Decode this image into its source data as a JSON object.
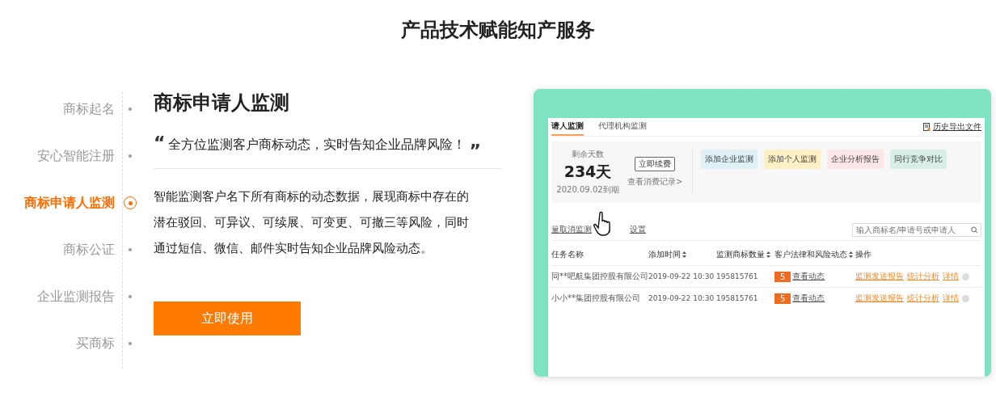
{
  "title": "产品技术赋能知产服务",
  "nav": {
    "items": [
      {
        "label": "商标起名",
        "selected": false
      },
      {
        "label": "安心智能注册",
        "selected": false
      },
      {
        "label": "商标申请人监测",
        "selected": true
      },
      {
        "label": "商标公证",
        "selected": false
      },
      {
        "label": "企业监测报告",
        "selected": false
      },
      {
        "label": "买商标",
        "selected": false
      }
    ]
  },
  "detail": {
    "heading": "商标申请人监测",
    "quote_open": "“",
    "quote": "全方位监测客户商标动态，实时告知企业品牌风险！",
    "quote_close": "”",
    "description": "智能监测客户名下所有商标的动态数据，展现商标中存在的潜在驳回、可异议、可续展、可变更、可撤三等风险，同时通过短信、微信、邮件实时告知企业品牌风险动态。",
    "button": "立即使用"
  },
  "preview": {
    "tabs": [
      {
        "label": "请人监测",
        "selected": true
      },
      {
        "label": "代理机构监测",
        "selected": false
      }
    ],
    "export_link": "历史导出文件",
    "days_label": "剩余天数",
    "days": "234天",
    "expiry": "2020.09.02到期",
    "renew_button": "立即续费",
    "records_link": "查看消费记录>",
    "cards": [
      {
        "label": "添加企业监测",
        "color": "#dff1f7"
      },
      {
        "label": "添加个人监测",
        "color": "#fdf0c4"
      },
      {
        "label": "企业分析报告",
        "color": "#fde6e6"
      },
      {
        "label": "同行竞争对比",
        "color": "#d7efe4"
      }
    ],
    "batch_link": "量取消监测",
    "settings_link": "设置",
    "search": {
      "placeholder": "输入商标名/申请号或申请人"
    },
    "table": {
      "columns": [
        "任务名称",
        "添加时间",
        "监测商标数量",
        "客户法律和风险动态",
        "操作"
      ],
      "rows": [
        {
          "name": "同**吧航集团控股有限公司",
          "time": "2019-09-22  10:30",
          "count": "195815761",
          "badge": "5",
          "status": "查看动态",
          "actions": [
            "监测发送报告",
            "统计分析",
            "详情"
          ]
        },
        {
          "name": "小小**集团控股有限公司",
          "time": "2019-09-22  10:30",
          "count": "195815761",
          "badge": "5",
          "status": "查看动态",
          "actions": [
            "监测发送报告",
            "统计分析",
            "详情"
          ]
        }
      ]
    }
  }
}
